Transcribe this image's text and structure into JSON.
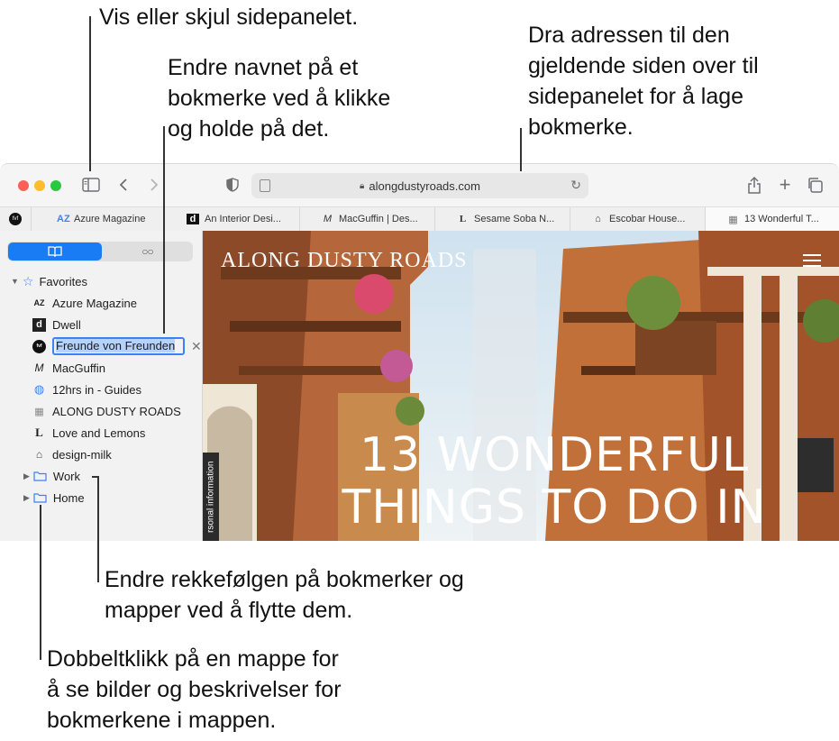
{
  "callouts": {
    "sidebar_toggle": "Vis eller skjul sidepanelet.",
    "rename": "Endre navnet på et\nbokmerke ved å klikke\nog holde på det.",
    "drag_address": "Dra adressen til den\ngjeldende siden over til\nsidepanelet for å lage\nbokmerke.",
    "reorder": "Endre rekkefølgen på bokmerker og\nmapper ved å flytte dem.",
    "double_click": "Dobbeltklikk på en mappe for\nå se bilder og beskrivelser for\nbokmerkene i mappen."
  },
  "toolbar": {
    "address": "alongdustyroads.com"
  },
  "tabs": [
    {
      "icon": "AZ",
      "label": "Azure Magazine"
    },
    {
      "icon": "d",
      "label": "An Interior Desi..."
    },
    {
      "icon": "M",
      "label": "MacGuffin | Des..."
    },
    {
      "icon": "L",
      "label": "Sesame Soba N..."
    },
    {
      "icon": "⌂",
      "label": "Escobar House..."
    },
    {
      "icon": "▦",
      "label": "13 Wonderful T..."
    }
  ],
  "pinned_tab_icon": "fvf",
  "sidebar": {
    "favorites_label": "Favorites",
    "bookmarks": [
      {
        "icon": "AZ",
        "label": "Azure Magazine"
      },
      {
        "icon": "d",
        "label": "Dwell"
      },
      {
        "icon": "fvf",
        "label": "Freunde von Freunden"
      },
      {
        "icon": "M",
        "label": "MacGuffin"
      },
      {
        "icon": "◍",
        "label": "12hrs in - Guides"
      },
      {
        "icon": "▦",
        "label": "ALONG DUSTY ROADS"
      },
      {
        "icon": "L",
        "label": "Love and Lemons"
      },
      {
        "icon": "⌂",
        "label": "design-milk"
      }
    ],
    "folders": [
      {
        "label": "Work"
      },
      {
        "label": "Home"
      }
    ]
  },
  "page": {
    "site_name": "ALONG DUSTY ROADS",
    "headline_line1": "13 WONDERFUL",
    "headline_line2": "THINGS TO DO IN",
    "side_tab": "rsonal information"
  },
  "colors": {
    "accent": "#1a7cf5",
    "close": "#fe5f57",
    "minimize": "#febc2e",
    "zoom": "#28c840"
  }
}
